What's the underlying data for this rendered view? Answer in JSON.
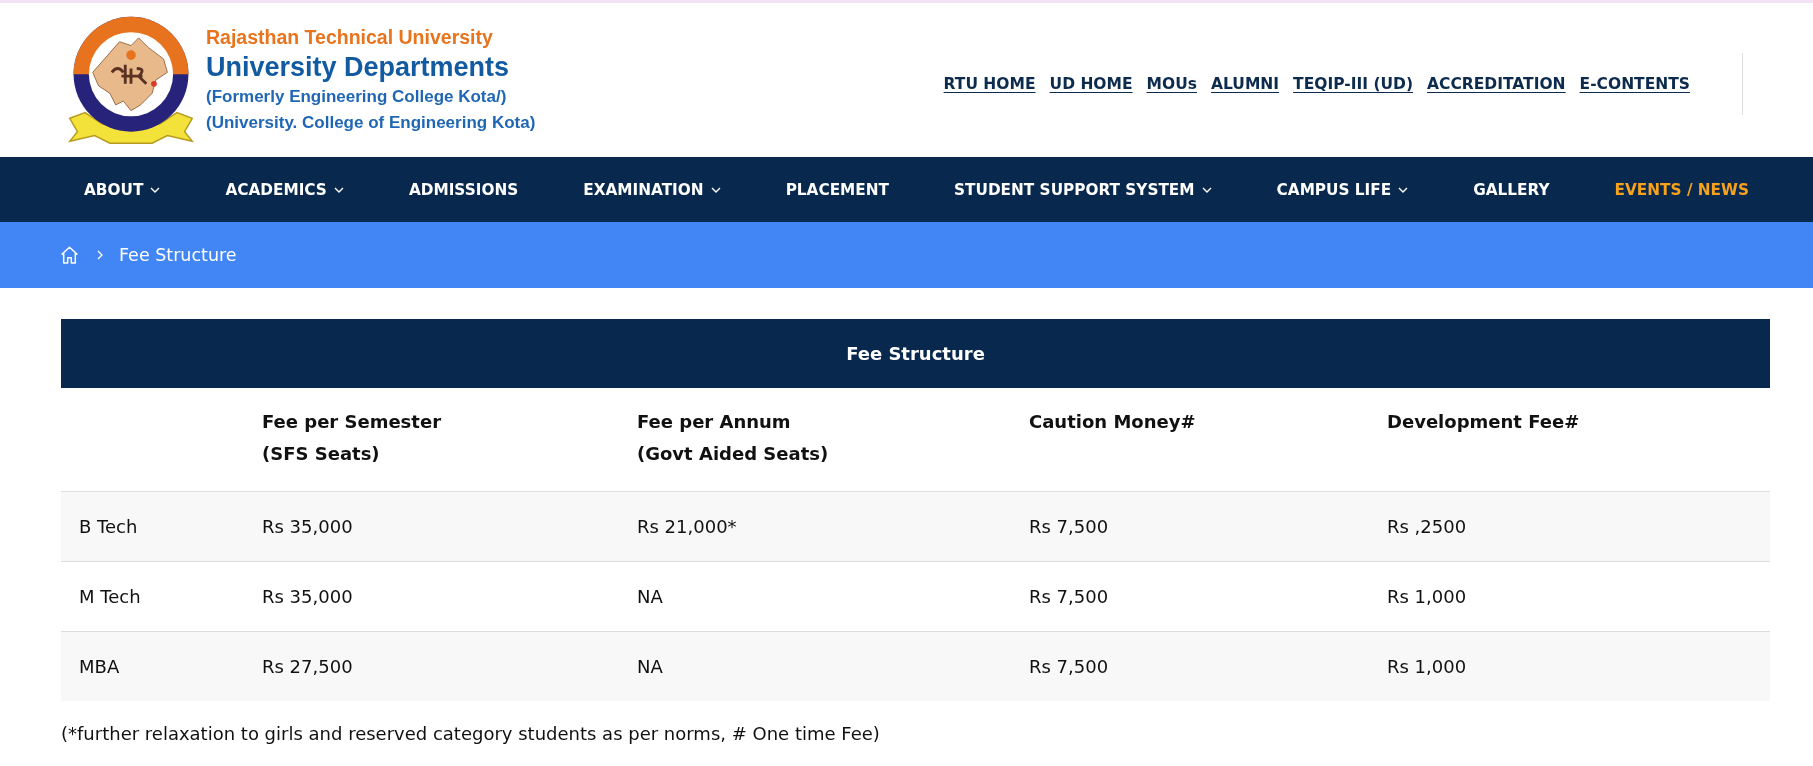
{
  "header": {
    "institution": "Rajasthan Technical University",
    "title": "University Departments",
    "subtitle_lines": [
      "(Formerly Engineering College Kota/)",
      "(University. College of Engineering Kota)"
    ]
  },
  "top_links": [
    {
      "label": "RTU HOME"
    },
    {
      "label": "UD HOME"
    },
    {
      "label": "MOUs"
    },
    {
      "label": "ALUMNI"
    },
    {
      "label": "TEQIP-III (UD)"
    },
    {
      "label": "ACCREDITATION"
    },
    {
      "label": "E-CONTENTS"
    }
  ],
  "nav": [
    {
      "label": "ABOUT",
      "dropdown": true,
      "highlighted": false
    },
    {
      "label": "ACADEMICS",
      "dropdown": true,
      "highlighted": false
    },
    {
      "label": "ADMISSIONS",
      "dropdown": false,
      "highlighted": false
    },
    {
      "label": "EXAMINATION",
      "dropdown": true,
      "highlighted": false
    },
    {
      "label": "PLACEMENT",
      "dropdown": false,
      "highlighted": false
    },
    {
      "label": "STUDENT SUPPORT SYSTEM",
      "dropdown": true,
      "highlighted": false
    },
    {
      "label": "CAMPUS LIFE",
      "dropdown": true,
      "highlighted": false
    },
    {
      "label": "GALLERY",
      "dropdown": false,
      "highlighted": false
    },
    {
      "label": "EVENTS / NEWS",
      "dropdown": false,
      "highlighted": true
    }
  ],
  "breadcrumb": {
    "current": "Fee Structure"
  },
  "table": {
    "title": "Fee Structure",
    "columns": [
      {
        "lines": [
          "Fee per Semester",
          "(SFS Seats)"
        ]
      },
      {
        "lines": [
          "Fee per Annum",
          "(Govt Aided Seats)"
        ]
      },
      {
        "lines": [
          "Caution Money#"
        ]
      },
      {
        "lines": [
          "Development Fee#"
        ]
      }
    ],
    "rows": [
      {
        "label": "B Tech",
        "values": [
          "Rs 35,000",
          "Rs 21,000*",
          "Rs 7,500",
          "Rs ,2500"
        ]
      },
      {
        "label": "M Tech",
        "values": [
          "Rs 35,000",
          "NA",
          "Rs 7,500",
          "Rs 1,000"
        ]
      },
      {
        "label": "MBA",
        "values": [
          "Rs 27,500",
          "NA",
          "Rs 7,500",
          "Rs 1,000"
        ]
      }
    ]
  },
  "note": "(*further relaxation to girls and reserved category students as per norms, # One time Fee)"
}
